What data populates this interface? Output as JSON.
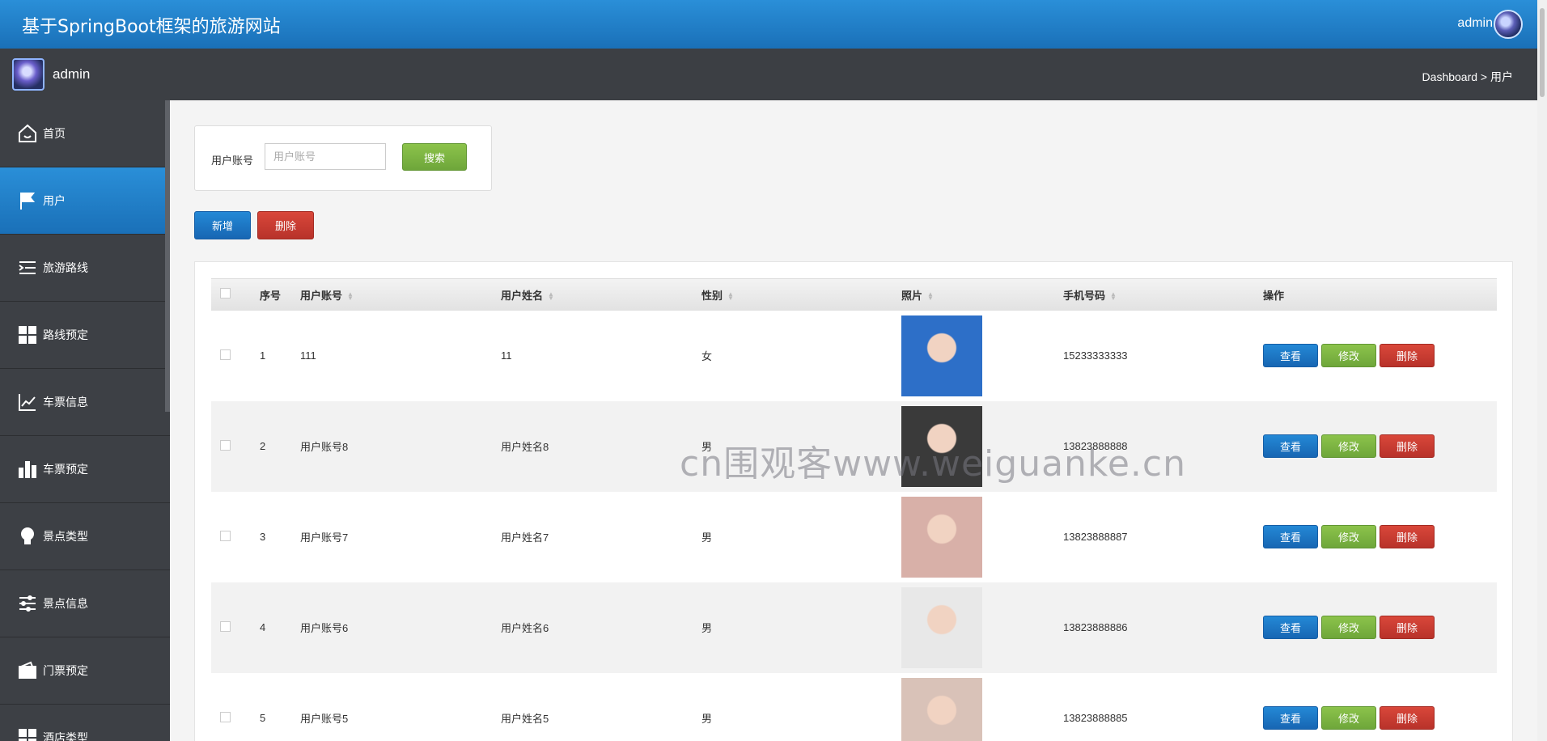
{
  "header": {
    "site_title": "基于SpringBoot框架的旅游网站",
    "user": "admin"
  },
  "subbar": {
    "user": "admin",
    "breadcrumb": "Dashboard > 用户"
  },
  "sidebar": {
    "items": [
      {
        "label": "首页",
        "icon": "home-icon"
      },
      {
        "label": "用户",
        "icon": "flag-icon",
        "active": true
      },
      {
        "label": "旅游路线",
        "icon": "indent-icon"
      },
      {
        "label": "路线预定",
        "icon": "grid-icon"
      },
      {
        "label": "车票信息",
        "icon": "trend-icon"
      },
      {
        "label": "车票预定",
        "icon": "bar-chart-icon"
      },
      {
        "label": "景点类型",
        "icon": "lightbulb-icon"
      },
      {
        "label": "景点信息",
        "icon": "sliders-icon"
      },
      {
        "label": "门票预定",
        "icon": "wallet-icon"
      },
      {
        "label": "酒店类型",
        "icon": "grid-icon"
      }
    ]
  },
  "search": {
    "label": "用户账号",
    "placeholder": "用户账号",
    "button": "搜索"
  },
  "actions": {
    "add": "新增",
    "delete": "删除"
  },
  "table": {
    "columns": [
      "序号",
      "用户账号",
      "用户姓名",
      "性别",
      "照片",
      "手机号码",
      "操作"
    ],
    "rows": [
      {
        "index": "1",
        "account": "111",
        "name": "11",
        "gender": "女",
        "phone": "15233333333",
        "photo_color": "#2d6fc8"
      },
      {
        "index": "2",
        "account": "用户账号8",
        "name": "用户姓名8",
        "gender": "男",
        "phone": "13823888888",
        "photo_color": "#3a3a3a"
      },
      {
        "index": "3",
        "account": "用户账号7",
        "name": "用户姓名7",
        "gender": "男",
        "phone": "13823888887",
        "photo_color": "#d8b0a8"
      },
      {
        "index": "4",
        "account": "用户账号6",
        "name": "用户姓名6",
        "gender": "男",
        "phone": "13823888886",
        "photo_color": "#e8e8e8"
      },
      {
        "index": "5",
        "account": "用户账号5",
        "name": "用户姓名5",
        "gender": "男",
        "phone": "13823888885",
        "photo_color": "#d9c2b8"
      }
    ],
    "row_buttons": {
      "view": "查看",
      "edit": "修改",
      "delete": "删除"
    }
  },
  "watermark": "cn围观客www.weiguanke.cn"
}
